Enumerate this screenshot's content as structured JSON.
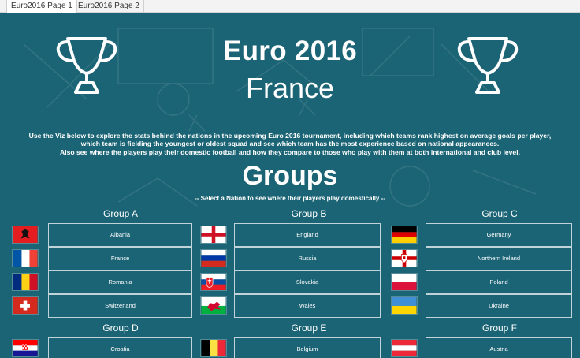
{
  "tabs": [
    {
      "label": "Euro2016 Page 1",
      "active": true
    },
    {
      "label": "Euro2016 Page 2",
      "active": false
    }
  ],
  "header": {
    "title": "Euro 2016",
    "host": "France",
    "icons": [
      "trophy-icon",
      "trophy-icon"
    ]
  },
  "intro": {
    "line1": "Use the Viz below to explore the stats behind the nations in the upcoming Euro 2016 tournament, including which teams rank highest on average goals per player,",
    "line2": "which team is fielding the youngest or oldest squad and see which team has the most experience based on national appearances.",
    "line3": "Also see where the players play their domestic football and how they compare to those who play with them at both international and club level."
  },
  "groups_section": {
    "heading": "Groups",
    "subtitle": "-- Select a Nation to see where their players play domestically --"
  },
  "groups": [
    {
      "name": "Group A",
      "teams": [
        "Albania",
        "France",
        "Romania",
        "Switzerland"
      ]
    },
    {
      "name": "Group B",
      "teams": [
        "England",
        "Russia",
        "Slovakia",
        "Wales"
      ]
    },
    {
      "name": "Group C",
      "teams": [
        "Germany",
        "Northern Ireland",
        "Poland",
        "Ukraine"
      ]
    },
    {
      "name": "Group D",
      "teams": [
        "Croatia"
      ]
    },
    {
      "name": "Group E",
      "teams": [
        "Belgium"
      ]
    },
    {
      "name": "Group F",
      "teams": [
        "Austria"
      ]
    }
  ],
  "colors": {
    "background": "#1b6475",
    "cell_border": "#bfd3d8",
    "text": "#ffffff"
  }
}
